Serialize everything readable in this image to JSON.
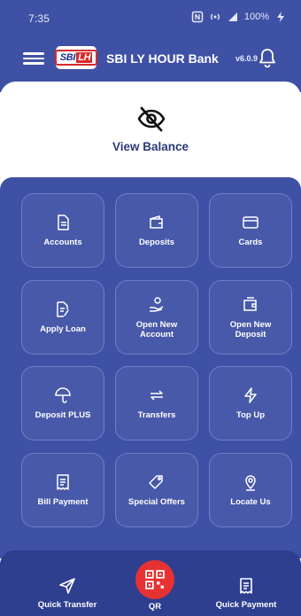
{
  "status_bar": {
    "time": "7:35",
    "battery": "100%"
  },
  "header": {
    "bank_name": "SBI LY HOUR Bank",
    "version": "v6.0.9",
    "logo_text_main": "SBI",
    "logo_text_accent": "LH"
  },
  "balance": {
    "label": "View Balance"
  },
  "tiles": [
    {
      "label": "Accounts"
    },
    {
      "label": "Deposits"
    },
    {
      "label": "Cards"
    },
    {
      "label": "Apply Loan"
    },
    {
      "label": "Open New\nAccount"
    },
    {
      "label": "Open New\nDeposit"
    },
    {
      "label": "Deposit PLUS"
    },
    {
      "label": "Transfers"
    },
    {
      "label": "Top Up"
    },
    {
      "label": "Bill Payment"
    },
    {
      "label": "Special Offers"
    },
    {
      "label": "Locate Us"
    }
  ],
  "bottom_nav": {
    "quick_transfer": "Quick Transfer",
    "qr": "QR",
    "quick_payment": "Quick Payment"
  },
  "colors": {
    "primary": "#3f51a5",
    "accent_red": "#e63232",
    "nav_dark": "#2f3f8f"
  }
}
